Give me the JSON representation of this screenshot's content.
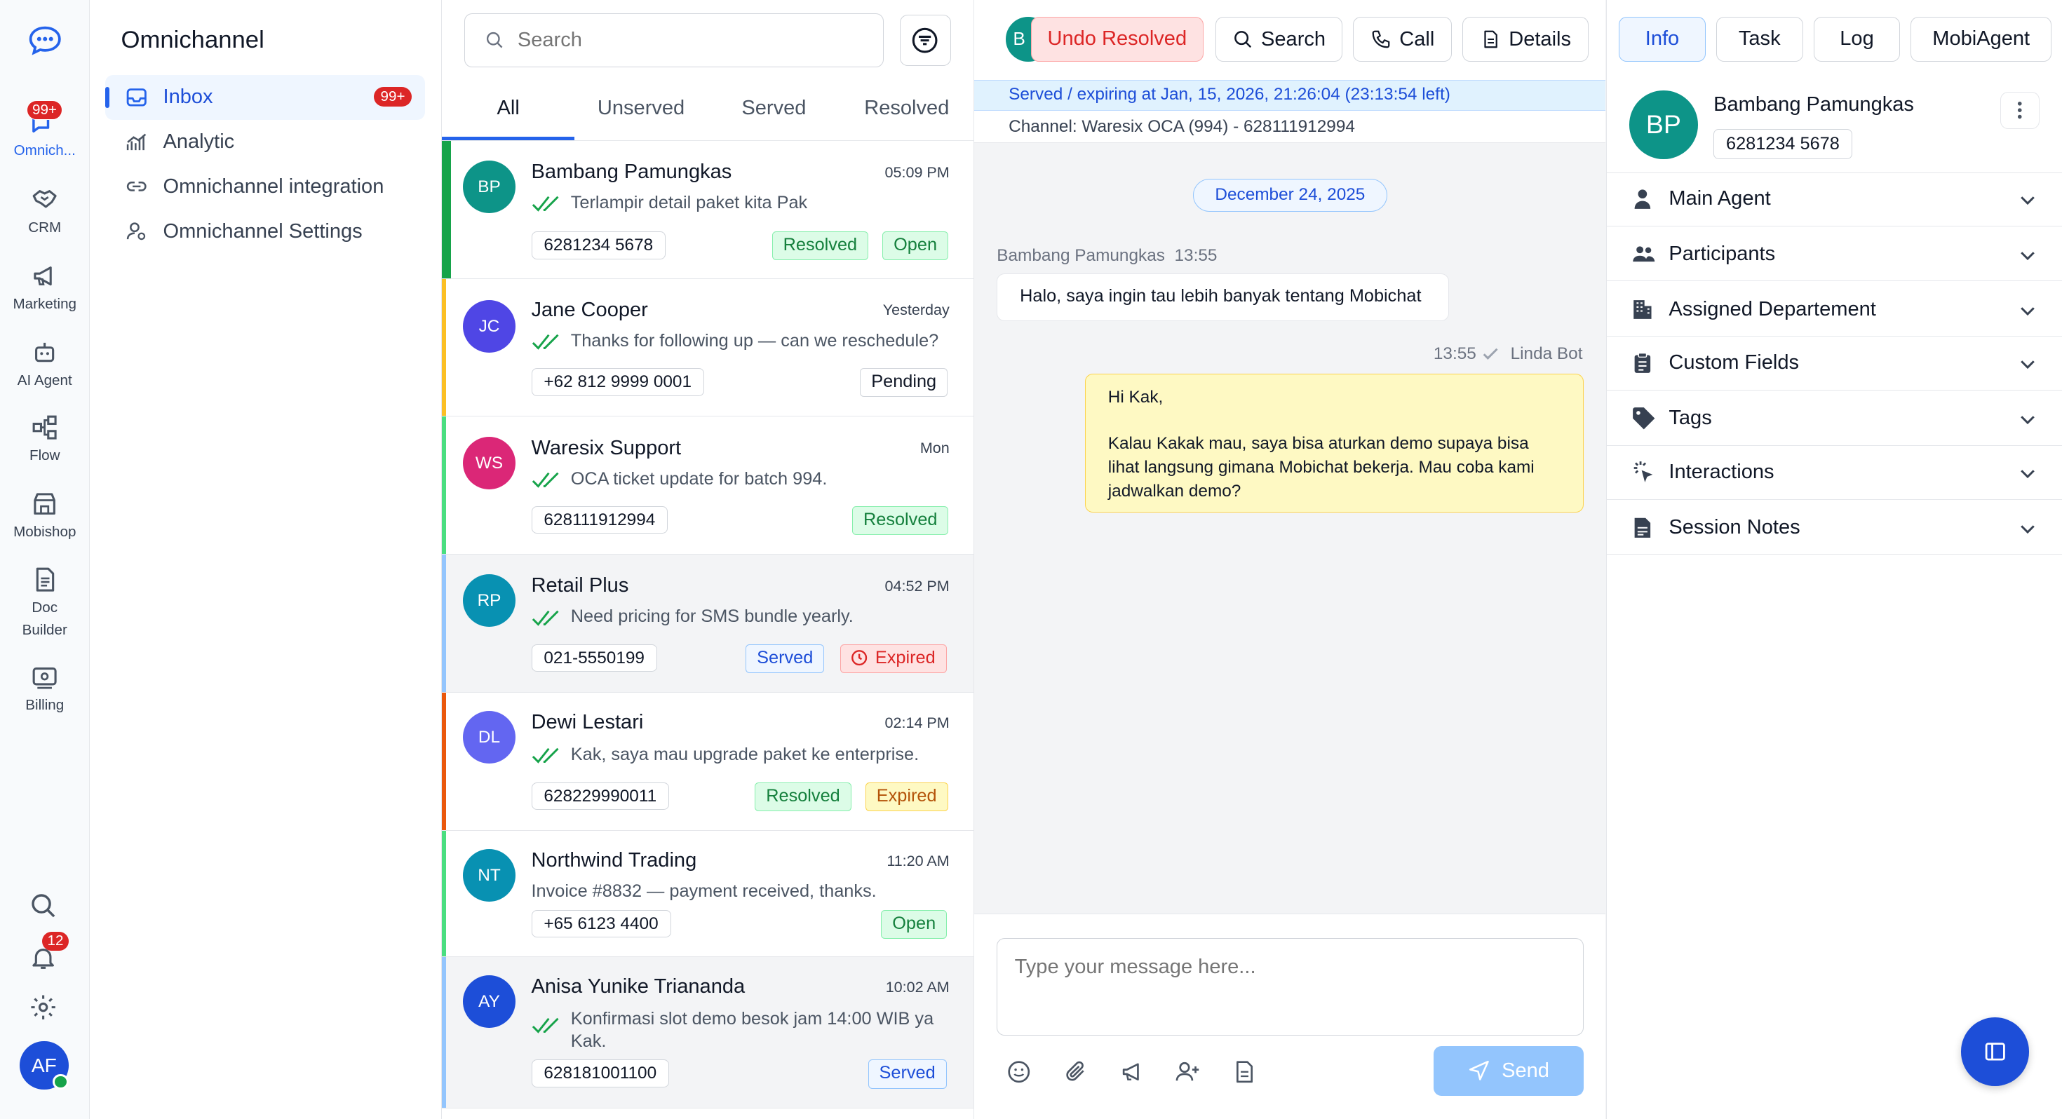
{
  "rail": {
    "items": [
      {
        "label": "Omnich...",
        "badge": "99+"
      },
      {
        "label": "CRM"
      },
      {
        "label": "Marketing"
      },
      {
        "label": "AI Agent"
      },
      {
        "label": "Flow"
      },
      {
        "label": "Mobishop"
      },
      {
        "label": "Doc Builder"
      },
      {
        "label": "Billing"
      }
    ],
    "notif_badge": "12",
    "user_initials": "AF"
  },
  "nav": {
    "title": "Omnichannel",
    "items": [
      {
        "label": "Inbox",
        "badge": "99+"
      },
      {
        "label": "Analytic"
      },
      {
        "label": "Omnichannel integration"
      },
      {
        "label": "Omnichannel Settings"
      }
    ]
  },
  "list": {
    "search_placeholder": "Search",
    "tabs": [
      "All",
      "Unserved",
      "Served",
      "Resolved"
    ],
    "conversations": [
      {
        "initials": "BP",
        "name": "Bambang Pamungkas",
        "time": "05:09 PM",
        "message": "Terlampir detail paket kita Pak",
        "phone": "6281234 5678",
        "tags": [
          "Resolved",
          "Open"
        ]
      },
      {
        "initials": "JC",
        "name": "Jane Cooper",
        "time": "Yesterday",
        "message": "Thanks for following up — can we reschedule?",
        "phone": "+62 812 9999 0001",
        "tags": [
          "Pending"
        ]
      },
      {
        "initials": "WS",
        "name": "Waresix Support",
        "time": "Mon",
        "message": "OCA ticket update for batch 994.",
        "phone": "628111912994",
        "tags": [
          "Resolved"
        ]
      },
      {
        "initials": "RP",
        "name": "Retail Plus",
        "time": "04:52 PM",
        "message": "Need pricing for SMS bundle yearly.",
        "phone": "021-5550199",
        "tags": [
          "Served",
          "Expired"
        ]
      },
      {
        "initials": "DL",
        "name": "Dewi Lestari",
        "time": "02:14 PM",
        "message": "Kak, saya mau upgrade paket ke enterprise.",
        "phone": "628229990011",
        "tags": [
          "Resolved",
          "Expired"
        ]
      },
      {
        "initials": "NT",
        "name": "Northwind Trading",
        "time": "11:20 AM",
        "message": "Invoice #8832 — payment received, thanks.",
        "phone": "+65 6123 4400",
        "tags": [
          "Open"
        ]
      },
      {
        "initials": "AY",
        "name": "Anisa Yunike Triananda",
        "time": "10:02 AM",
        "message": "Konfirmasi slot demo besok jam 14:00 WIB ya Kak.",
        "phone": "628181001100",
        "tags": [
          "Served"
        ]
      }
    ]
  },
  "chat": {
    "undo_label": "Undo Resolved",
    "search_label": "Search",
    "call_label": "Call",
    "details_label": "Details",
    "header_initial": "B",
    "status_line": "Served / expiring at Jan, 15, 2026, 21:26:04 (23:13:54 left)",
    "channel_line": "Channel: Waresix OCA (994) - 628111912994",
    "date_pill": "December 24, 2025",
    "incoming": {
      "sender": "Bambang Pamungkas",
      "time": "13:55",
      "text": "Halo, saya ingin tau lebih banyak tentang Mobichat"
    },
    "outgoing": {
      "time": "13:55",
      "sender": "Linda Bot",
      "line1": "Hi Kak,",
      "line2": "Kalau Kakak mau, saya bisa aturkan demo supaya bisa lihat langsung gimana Mobichat bekerja. Mau coba kami jadwalkan demo?"
    },
    "composer_placeholder": "Type your message here...",
    "send_label": "Send"
  },
  "right": {
    "tabs": [
      "Info",
      "Task",
      "Log",
      "MobiAgent"
    ],
    "contact": {
      "initials": "BP",
      "name": "Bambang Pamungkas",
      "phone": "6281234 5678"
    },
    "sections": [
      "Main Agent",
      "Participants",
      "Assigned Departement",
      "Custom Fields",
      "Tags",
      "Interactions",
      "Session Notes"
    ]
  },
  "colors": {
    "accent": "#2563eb",
    "teal": "#0d9488",
    "danger": "#dc2626",
    "success": "#16a34a"
  }
}
